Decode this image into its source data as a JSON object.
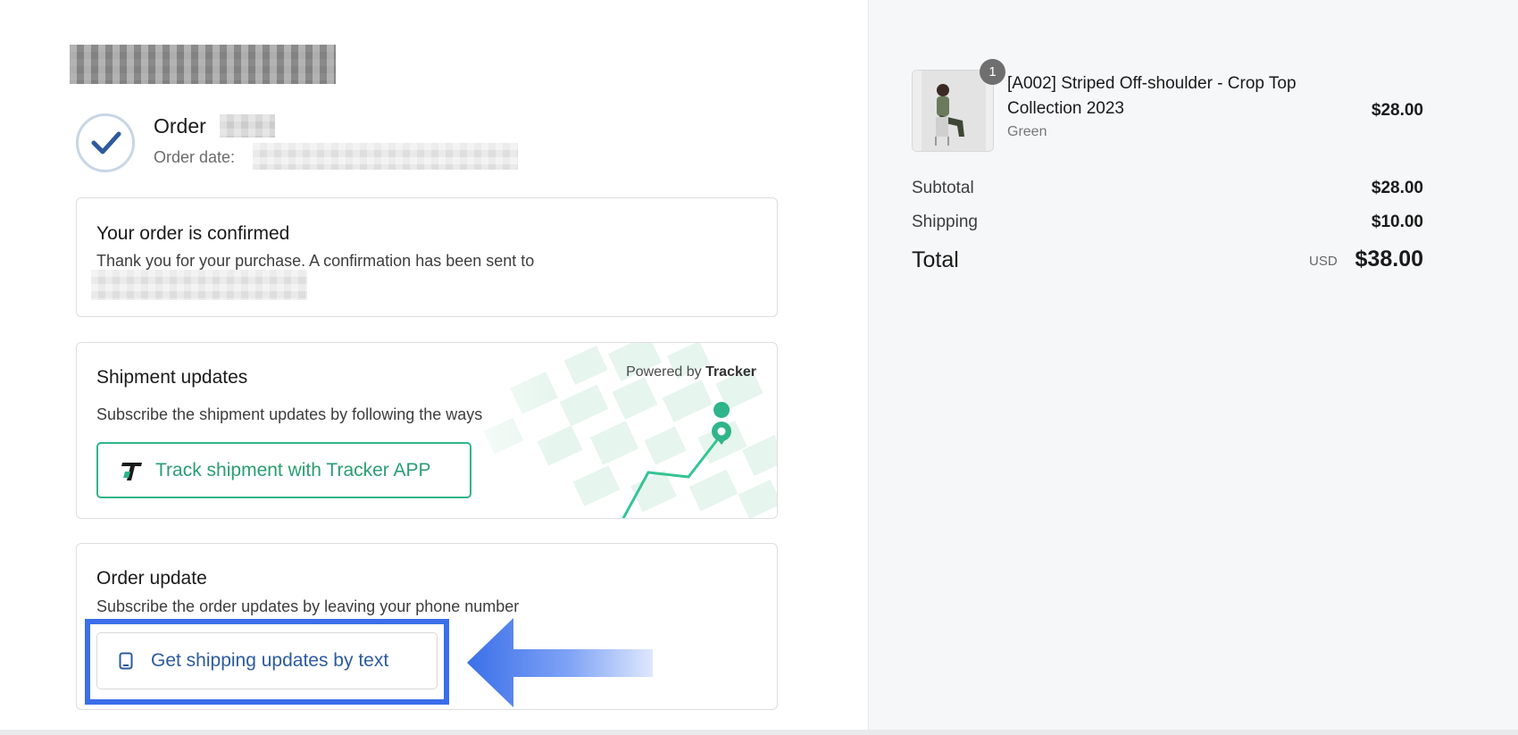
{
  "header": {
    "order_label": "Order",
    "order_date_label": "Order date:"
  },
  "confirmation": {
    "title": "Your order is confirmed",
    "message": "Thank you for your purchase. A confirmation has been sent to"
  },
  "shipment": {
    "title": "Shipment updates",
    "description": "Subscribe the shipment updates by following the ways",
    "powered_by_prefix": "Powered by",
    "powered_by_brand": "Tracker",
    "track_button_label": "Track shipment with Tracker APP",
    "track_icon": "tracker-t-icon",
    "accent_color": "#2fb58a"
  },
  "order_update": {
    "title": "Order update",
    "description": "Subscribe the order updates by leaving your phone number",
    "sms_button_label": "Get shipping updates by text",
    "sms_icon": "phone-icon",
    "highlight_color": "#3b6fe9"
  },
  "summary": {
    "item": {
      "quantity": "1",
      "name": "[A002] Striped Off-shoulder - Crop Top Collection 2023",
      "variant": "Green",
      "price": "$28.00"
    },
    "subtotal_label": "Subtotal",
    "subtotal_value": "$28.00",
    "shipping_label": "Shipping",
    "shipping_value": "$10.00",
    "total_label": "Total",
    "currency": "USD",
    "total_value": "$38.00"
  }
}
